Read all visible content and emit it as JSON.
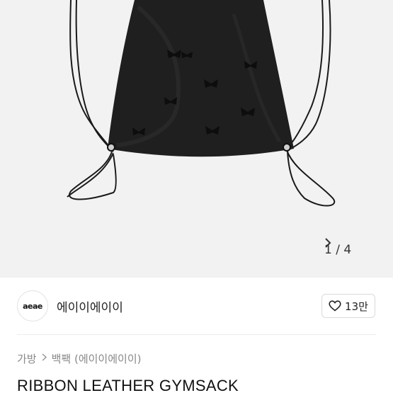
{
  "product_image": {
    "pager_text": "1 / 4",
    "pager_icon": "chevron-right-icon"
  },
  "seller": {
    "logo_text": "aeae",
    "name": "에이이에이이",
    "like_icon": "heart-outline-icon",
    "like_count": "13만"
  },
  "breadcrumb": {
    "items": [
      "가방",
      "백팩 (에이이에이이)"
    ],
    "separator_icon": "chevron-right-icon"
  },
  "product": {
    "title": "RIBBON LEATHER GYMSACK"
  }
}
